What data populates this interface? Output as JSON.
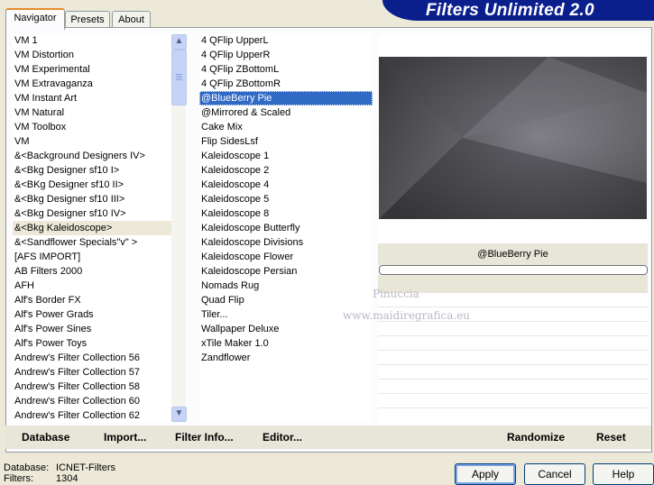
{
  "title": "Filters Unlimited 2.0",
  "tabs": [
    {
      "label": "Navigator",
      "active": true
    },
    {
      "label": "Presets",
      "active": false
    },
    {
      "label": "About",
      "active": false
    }
  ],
  "categories": [
    "VM 1",
    "VM Distortion",
    "VM Experimental",
    "VM Extravaganza",
    "VM Instant Art",
    "VM Natural",
    "VM Toolbox",
    "VM",
    "&<Background Designers IV>",
    "&<Bkg Designer sf10 I>",
    "&<BKg Designer sf10 II>",
    "&<Bkg Designer sf10 III>",
    "&<Bkg Designer sf10 IV>",
    "&<Bkg Kaleidoscope>",
    "&<Sandflower Specials\"v\" >",
    "[AFS IMPORT]",
    "AB Filters 2000",
    "AFH",
    "Alf's Border FX",
    "Alf's Power Grads",
    "Alf's Power Sines",
    "Alf's Power Toys",
    "Andrew's Filter Collection 56",
    "Andrew's Filter Collection 57",
    "Andrew's Filter Collection 58",
    "Andrew's Filter Collection 60",
    "Andrew's Filter Collection 62"
  ],
  "selected_category": "&<Bkg Kaleidoscope>",
  "filters": [
    "4 QFlip UpperL",
    "4 QFlip UpperR",
    "4 QFlip ZBottomL",
    "4 QFlip ZBottomR",
    "@BlueBerry Pie",
    "@Mirrored & Scaled",
    "Cake Mix",
    "Flip SidesLsf",
    "Kaleidoscope 1",
    "Kaleidoscope 2",
    "Kaleidoscope 4",
    "Kaleidoscope 5",
    "Kaleidoscope 8",
    "Kaleidoscope Butterfly",
    "Kaleidoscope Divisions",
    "Kaleidoscope Flower",
    "Kaleidoscope Persian",
    "Nomads Rug",
    "Quad Flip",
    "Tiler...",
    "Wallpaper Deluxe",
    "xTile Maker 1.0",
    "Zandflower"
  ],
  "selected_filter": "@BlueBerry Pie",
  "preview": {
    "filter_name": "@BlueBerry Pie",
    "progress": 0
  },
  "watermark": {
    "line1": "Pinuccia",
    "line2": "www.maidiregrafica.eu"
  },
  "left_buttons": [
    {
      "label": "Database"
    },
    {
      "label": "Import..."
    },
    {
      "label": "Filter Info..."
    },
    {
      "label": "Editor..."
    }
  ],
  "right_buttons": [
    {
      "label": "Randomize"
    },
    {
      "label": "Reset"
    }
  ],
  "status": {
    "database_label": "Database:",
    "database_value": "ICNET-Filters",
    "filters_label": "Filters:",
    "filters_value": "1304"
  },
  "dialog_buttons": {
    "apply": "Apply",
    "cancel": "Cancel",
    "help": "Help"
  },
  "colors": {
    "banner": "#0a1f8c",
    "selection": "#316ac5"
  }
}
